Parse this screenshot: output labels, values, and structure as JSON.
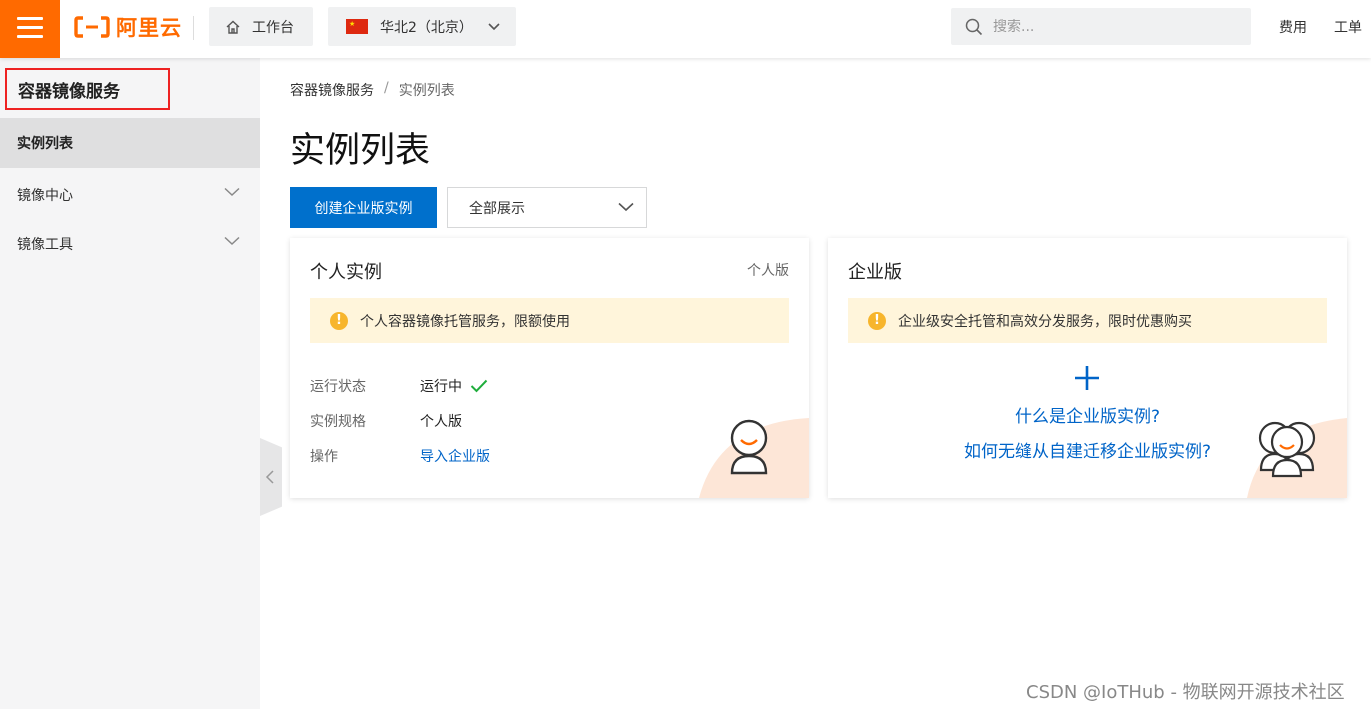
{
  "header": {
    "logo_text": "阿里云",
    "workbench_label": "工作台",
    "region_label": "华北2（北京）",
    "search_placeholder": "搜索...",
    "links": [
      "费用",
      "工单"
    ],
    "brand_color": "#ff6a00"
  },
  "sidebar": {
    "title": "容器镜像服务",
    "items": [
      {
        "label": "实例列表",
        "active": true
      },
      {
        "label": "镜像中心",
        "expandable": true
      },
      {
        "label": "镜像工具",
        "expandable": true
      }
    ]
  },
  "main": {
    "breadcrumb": [
      "容器镜像服务",
      "实例列表"
    ],
    "title": "实例列表",
    "create_button": "创建企业版实例",
    "filter_select": "全部展示",
    "personal_card": {
      "title": "个人实例",
      "tag": "个人版",
      "notice": "个人容器镜像托管服务，限额使用",
      "rows": [
        {
          "key": "运行状态",
          "value": "运行中"
        },
        {
          "key": "实例规格",
          "value": "个人版"
        },
        {
          "key": "操作",
          "value": "导入企业版"
        }
      ]
    },
    "enterprise_card": {
      "title": "企业版",
      "notice": "企业级安全托管和高效分发服务，限时优惠购买",
      "link_1": "什么是企业版实例?",
      "link_2": "如何无缝从自建迁移企业版实例?"
    }
  },
  "watermark": "CSDN @IoTHub - 物联网开源技术社区",
  "colors": {
    "primary": "#0070cc",
    "link": "#0064c8",
    "notice_bg": "#fff5db",
    "warning": "#f7b52c",
    "success": "#1fad3c"
  }
}
